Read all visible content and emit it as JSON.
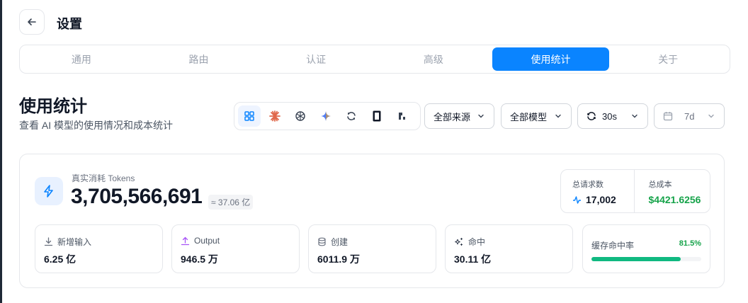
{
  "header": {
    "title": "设置"
  },
  "tabs": [
    {
      "label": "通用",
      "active": false
    },
    {
      "label": "路由",
      "active": false
    },
    {
      "label": "认证",
      "active": false
    },
    {
      "label": "高级",
      "active": false
    },
    {
      "label": "使用统计",
      "active": true
    },
    {
      "label": "关于",
      "active": false
    }
  ],
  "page": {
    "title": "使用统计",
    "subtitle": "查看 AI 模型的使用情况和成本统计"
  },
  "providers": [
    {
      "icon": "grid-icon",
      "active": true
    },
    {
      "icon": "anthropic-icon",
      "active": false
    },
    {
      "icon": "openai-icon",
      "active": false
    },
    {
      "icon": "gemini-icon",
      "active": false
    },
    {
      "icon": "refresh-circle-icon",
      "active": false
    },
    {
      "icon": "phone-icon",
      "active": false
    },
    {
      "icon": "provider-icon",
      "active": false
    }
  ],
  "filters": {
    "source": "全部来源",
    "model": "全部模型",
    "refresh": "30s",
    "range": "7d"
  },
  "stats": {
    "tokens_label": "真实消耗 Tokens",
    "tokens_value": "3,705,566,691",
    "tokens_approx": "≈ 37.06 亿",
    "requests_label": "总请求数",
    "requests_value": "17,002",
    "cost_label": "总成本",
    "cost_value": "$4421.6256",
    "new_input_label": "新增输入",
    "new_input_value": "6.25 亿",
    "output_label": "Output",
    "output_value": "946.5 万",
    "create_label": "创建",
    "create_value": "6011.9 万",
    "hit_label": "命中",
    "hit_value": "30.11 亿",
    "cache_rate_label": "缓存命中率",
    "cache_rate_value": "81.5%",
    "cache_rate_fraction": 0.815
  },
  "colors": {
    "accent": "#0a84ff",
    "success": "#16a34a",
    "bar": "#10b981"
  }
}
